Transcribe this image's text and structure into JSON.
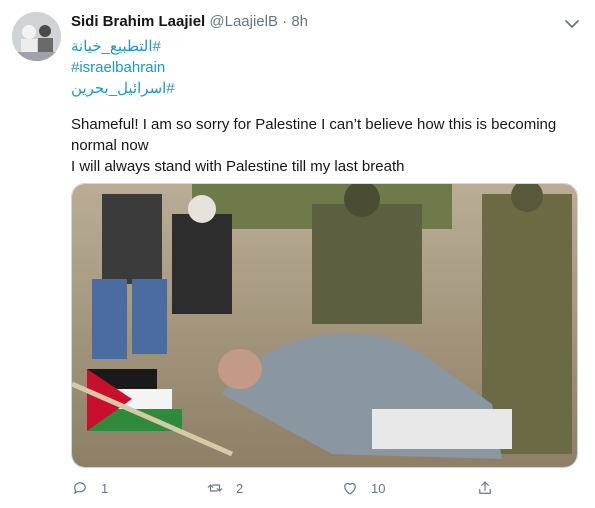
{
  "tweet": {
    "author_name": "Sidi Brahim Laajiel",
    "handle": "@LaajielB",
    "separator": "·",
    "time": "8h",
    "hashtags": [
      "#التطبيع_خيانة",
      "#israelbahrain",
      "#اسرائيل_بحرين"
    ],
    "text_lines": [
      "Shameful! I am so sorry for Palestine I can’t believe how this is becoming normal now",
      "I will always stand with Palestine till my last breath"
    ],
    "actions": {
      "reply_count": "1",
      "retweet_count": "2",
      "like_count": "10",
      "share_count": ""
    }
  },
  "colors": {
    "link": "#1b95e0",
    "secondary_text": "#657786",
    "primary_text": "#14171a"
  },
  "icons": [
    "chevron-down-icon",
    "reply-icon",
    "retweet-icon",
    "like-icon",
    "share-icon"
  ]
}
